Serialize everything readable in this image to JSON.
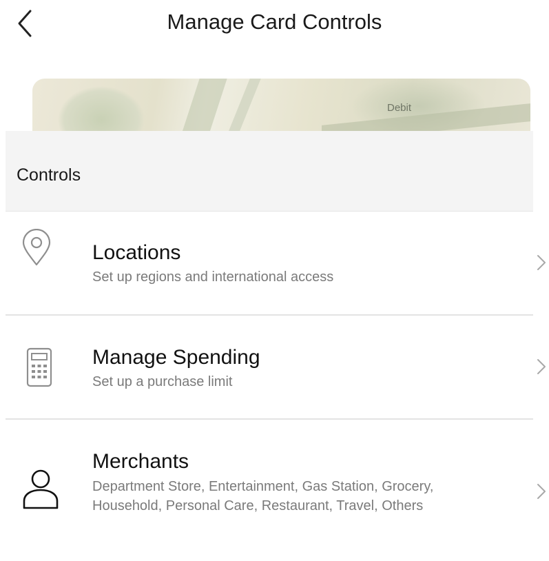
{
  "header": {
    "title": "Manage Card Controls"
  },
  "card": {
    "label": "Debit"
  },
  "section": {
    "title": "Controls"
  },
  "rows": [
    {
      "title": "Locations",
      "subtitle": "Set up regions and international access",
      "icon": "location-pin-icon"
    },
    {
      "title": "Manage Spending",
      "subtitle": "Set up a purchase limit",
      "icon": "calculator-icon"
    },
    {
      "title": "Merchants",
      "subtitle": "Department Store, Entertainment, Gas Station, Grocery, Household, Personal Care, Restaurant, Travel, Others",
      "icon": "person-icon"
    }
  ],
  "colors": {
    "chevron": "#a8a8a8",
    "icon_gray": "#8e8e8e",
    "section_bg": "#f4f4f4"
  }
}
